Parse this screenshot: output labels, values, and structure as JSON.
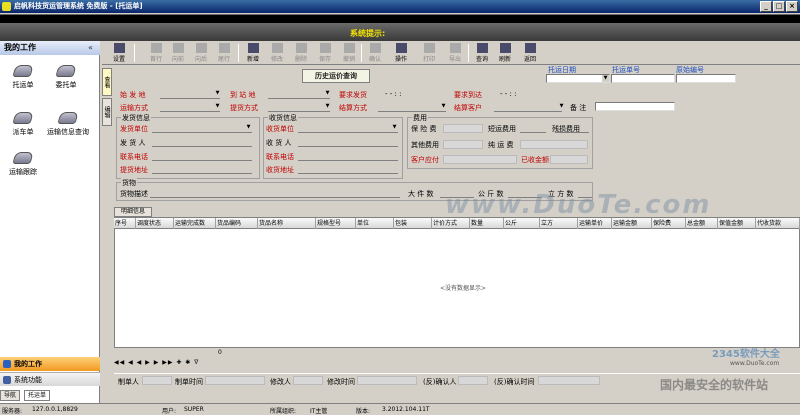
{
  "window": {
    "title": "启帆科技货运管理系统 免费版 - [托运单]",
    "btn_min": "_",
    "btn_max": "□",
    "btn_close": "×"
  },
  "message_bar": {
    "title": "系统提示:"
  },
  "left_panel": {
    "header": "我的工作",
    "collapse": "«",
    "items": [
      {
        "label": "托运单"
      },
      {
        "label": "委托单"
      },
      {
        "label": "派车单"
      },
      {
        "label": "运输信息查询"
      },
      {
        "label": "运输跟踪"
      }
    ],
    "bottom_my_work": "我的工作",
    "bottom_sys": "系统功能"
  },
  "toolbar": {
    "buttons": [
      {
        "label": "设置",
        "enabled": true
      },
      {
        "label": "首行",
        "enabled": false
      },
      {
        "label": "向前",
        "enabled": false
      },
      {
        "label": "向后",
        "enabled": false
      },
      {
        "label": "尾行",
        "enabled": false
      },
      {
        "label": "新增",
        "enabled": true
      },
      {
        "label": "修改",
        "enabled": false
      },
      {
        "label": "删除",
        "enabled": false
      },
      {
        "label": "保存",
        "enabled": false
      },
      {
        "label": "撤销",
        "enabled": false
      },
      {
        "label": "确认",
        "enabled": false
      },
      {
        "label": "操作",
        "enabled": true
      },
      {
        "label": "打印",
        "enabled": false
      },
      {
        "label": "导出",
        "enabled": false
      },
      {
        "label": "查询",
        "enabled": true
      },
      {
        "label": "刷新",
        "enabled": true
      },
      {
        "label": "返回",
        "enabled": true
      }
    ]
  },
  "side_tabs": [
    "查看",
    "编辑"
  ],
  "top_right": {
    "order_date_label": "托运日期",
    "order_no_label": "托运单号",
    "orig_no_label": "原始编号"
  },
  "form": {
    "history_button": "历史运价查询",
    "origin": "始 发 地",
    "dest": "到 站 地",
    "req_depart": "要求发货",
    "req_arrive": "要求到达",
    "date_placeholder": "- -    : :",
    "transport": "运输方式",
    "pickup": "提货方式",
    "settle": "结算方式",
    "settle_customer": "结算客户",
    "remark": "备 注",
    "ship_group": "发货信息",
    "ship_unit": "发货单位",
    "shipper": "发 货 人",
    "ship_phone": "联系电话",
    "ship_addr": "提货地址",
    "recv_group": "收货信息",
    "recv_unit": "收货单位",
    "receiver": "收 货 人",
    "recv_phone": "联系电话",
    "recv_addr": "收货地址",
    "fee_group": "费用",
    "insured": "保 险 费",
    "short_fee": "短运费用",
    "other_fee": "残损费用",
    "other_cost": "其他费用",
    "freight": "纯 运 费",
    "cust_payable": "客户应付",
    "paid": "已收金额",
    "cargo_group": "货物",
    "cargo_desc": "货物描述",
    "pieces": "大 件 数",
    "kg": "公 斤 数",
    "cbm": "立 方 数"
  },
  "detail": {
    "tab": "明细信息",
    "columns": [
      "序号",
      "调度状态",
      "运输完成数",
      "货品编码",
      "货品名称",
      "规格型号",
      "单位",
      "包装",
      "计价方式",
      "数量",
      "公斤",
      "立方",
      "运输单价",
      "运输金额",
      "保险费",
      "总金额",
      "保值金额",
      "代收货款"
    ],
    "empty": "<没有数据显示>",
    "footer_value": "0",
    "nav": "◀◀ ◀ ◀ ▶ ▶ ▶▶ ✚ ✱ ∇"
  },
  "footer_fields": {
    "maker": "制单人",
    "make_time": "制单时间",
    "modifier": "修改人",
    "modify_time": "修改时间",
    "confirmer": "(反)确认人",
    "confirm_time": "(反)确认时间"
  },
  "bottom_tabs": [
    "导航",
    "托运单"
  ],
  "status_bar": {
    "server_label": "服务器:",
    "server": "127.0.0.1,8829",
    "user_label": "用户:",
    "user": "SUPER",
    "org_label": "所属组织:",
    "org": "IT主管",
    "ver_label": "版本:",
    "ver": "3.2012.104.11T"
  },
  "watermarks": {
    "center": "www.DuoTe.com",
    "site": "www.DuoTe.com",
    "brand": "2345软件大全",
    "slogan": "国内最安全的软件站"
  }
}
